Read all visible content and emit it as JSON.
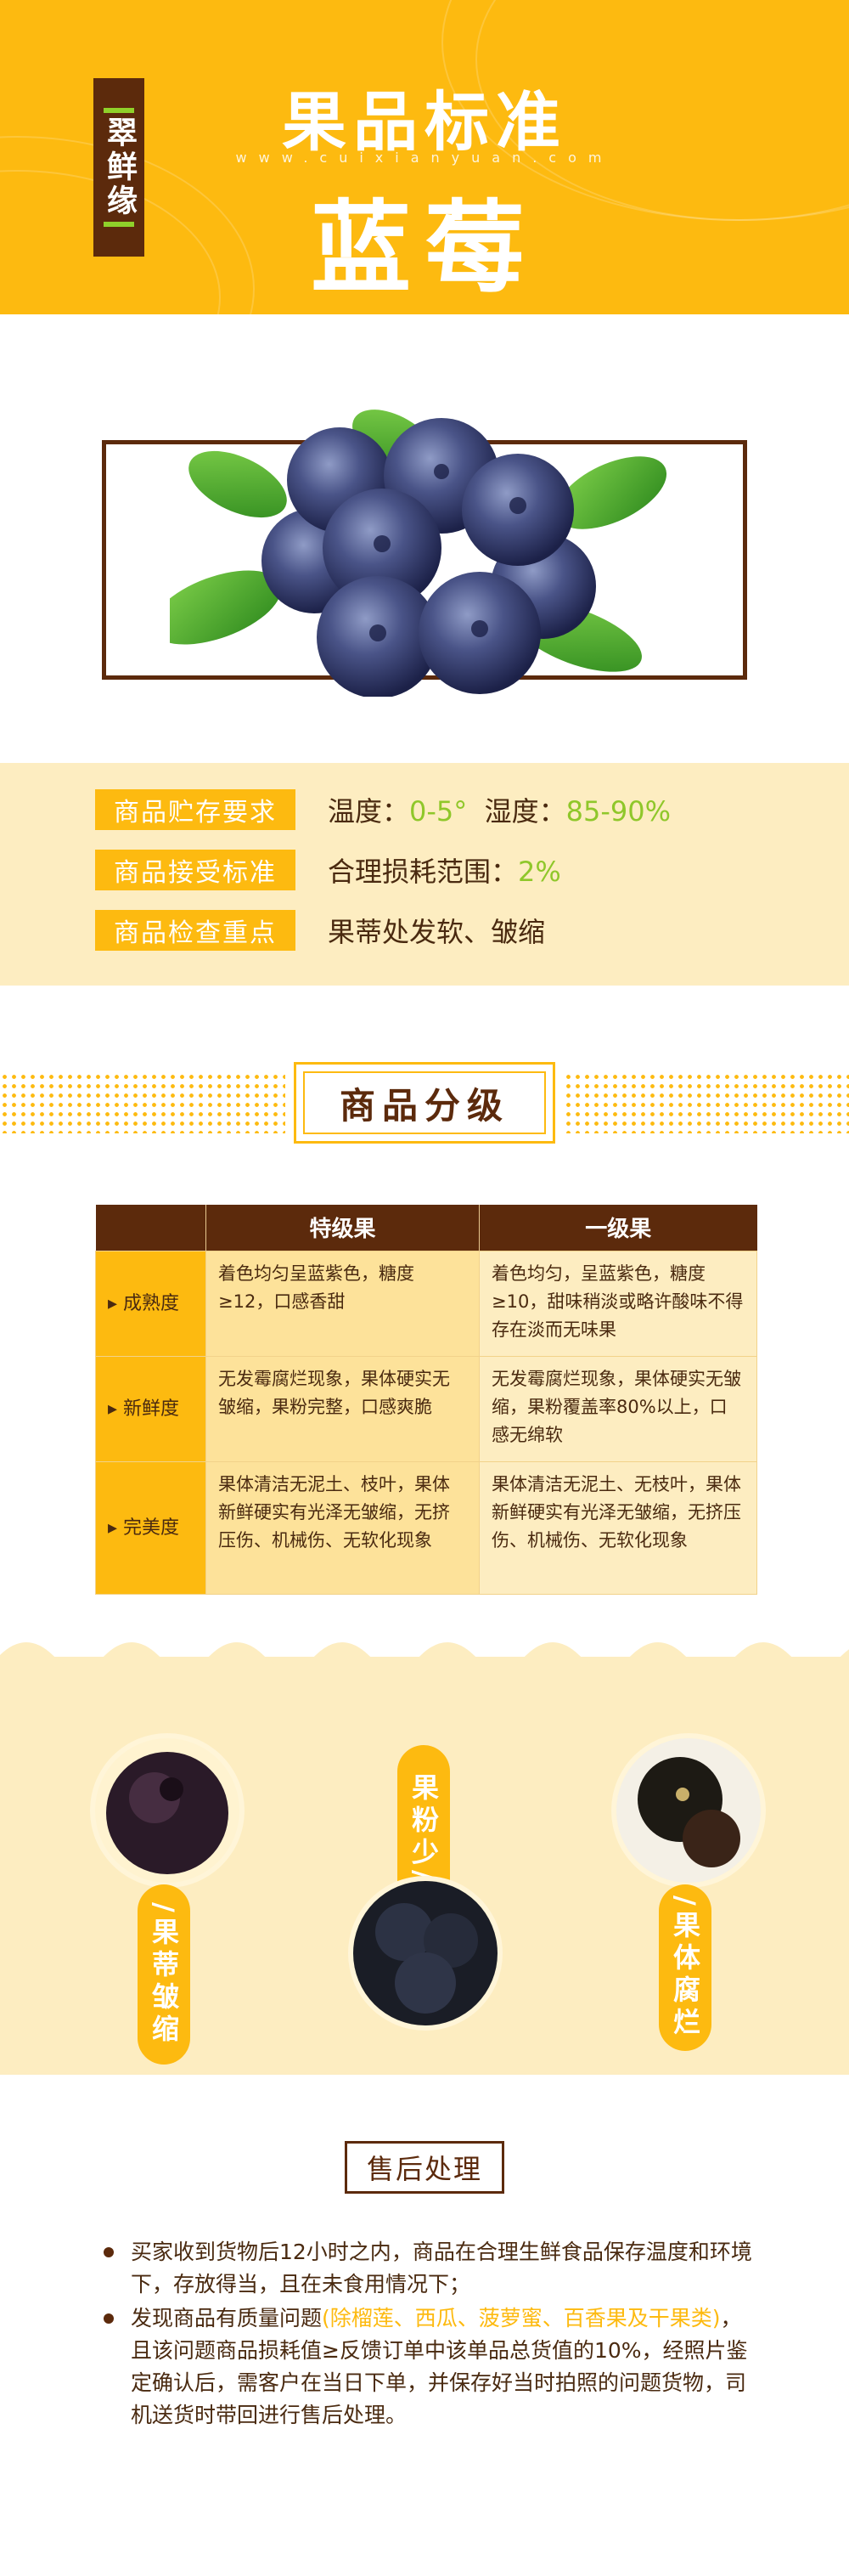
{
  "brand": {
    "name": "翠鲜缘",
    "url": "www.cuixianyuan.com"
  },
  "header": {
    "title_top": "果品标准",
    "title_main": "蓝莓"
  },
  "info": [
    {
      "tag": "商品贮存要求",
      "text_parts": [
        "温度：",
        "0-5°",
        "  湿度：",
        "85-90%"
      ]
    },
    {
      "tag": "商品接受标准",
      "text_parts": [
        "合理损耗范围：",
        "2%"
      ]
    },
    {
      "tag": "商品检查重点",
      "text_parts": [
        "果蒂处发软、皱缩"
      ]
    }
  ],
  "grade": {
    "title": "商品分级",
    "columns": [
      "",
      "特级果",
      "一级果"
    ],
    "rows": [
      {
        "label": "成熟度",
        "premium": "着色均匀呈蓝紫色，糖度≥12，口感香甜",
        "first": "着色均匀，呈蓝紫色，糖度≥10，甜味稍淡或略许酸味不得存在淡而无味果"
      },
      {
        "label": "新鲜度",
        "premium": "无发霉腐烂现象，果体硬实无皱缩，果粉完整，口感爽脆",
        "first": "无发霉腐烂现象，果体硬实无皱缩，果粉覆盖率80%以上，口感无绵软"
      },
      {
        "label": "完美度",
        "premium": "果体清洁无泥土、枝叶，果体新鲜硬实有光泽无皱缩，无挤压伤、机械伤、无软化现象",
        "first": "果体清洁无泥土、无枝叶，果体新鲜硬实有光泽无皱缩，无挤压伤、机械伤、无软化现象"
      }
    ]
  },
  "defects": [
    {
      "label": "/果蒂皱缩"
    },
    {
      "label": "果粉少/"
    },
    {
      "label": "/果体腐烂"
    }
  ],
  "after_sales": {
    "title": "售后处理",
    "items": [
      {
        "parts": [
          "买家收到货物后12小时之内，商品在合理生鲜食品保存温度和环境下，存放得当，且在未食用情况下；"
        ]
      },
      {
        "parts": [
          "发现商品有质量问题",
          "(除榴莲、西瓜、菠萝蜜、百香果及干果类)",
          "，且该问题商品损耗值≥反馈订单中该单品总货值的10%，经照片鉴定确认后，需客户在当日下单，并保存好当时拍照的问题货物，司机送货时带回进行售后处理。"
        ]
      }
    ]
  },
  "colors": {
    "yellow": "#fdba10",
    "brown": "#5c2a0c",
    "cream": "#fdedc1",
    "green": "#8fc72a"
  }
}
